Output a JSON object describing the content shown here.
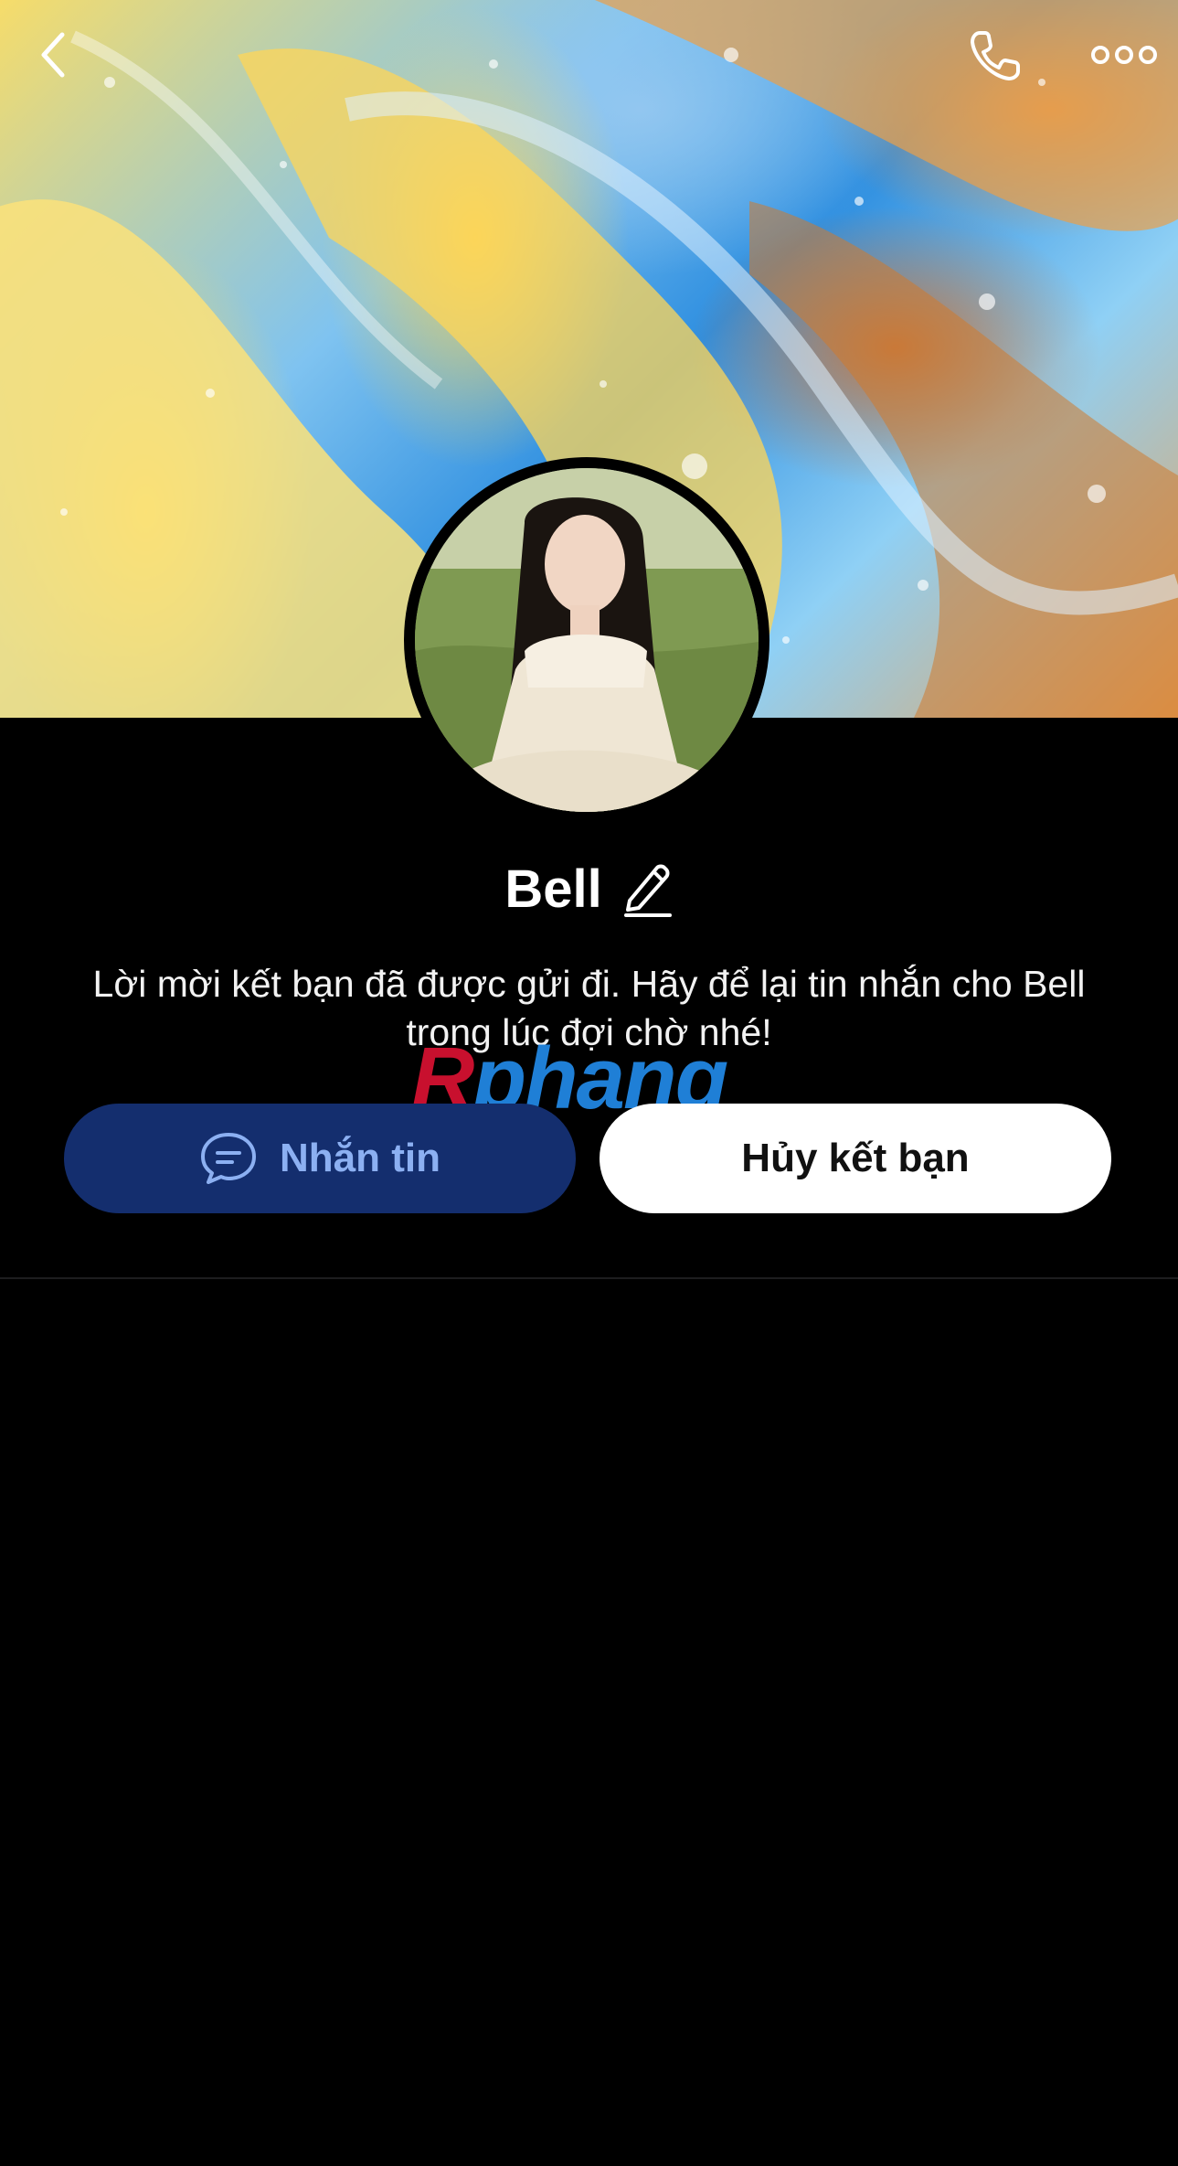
{
  "header": {
    "back_icon": "chevron-left-icon",
    "call_icon": "phone-icon",
    "more_icon": "more-dots-icon"
  },
  "profile": {
    "name": "Bell",
    "edit_icon": "pencil-icon",
    "status_message": "Lời mời kết bạn đã được gửi đi. Hãy để lại tin nhắn cho Bell trong lúc đợi chờ nhé!"
  },
  "actions": {
    "message_label": "Nhắn tin",
    "message_icon": "chat-bubble-icon",
    "unfriend_label": "Hủy kết bạn"
  },
  "watermark": {
    "r": "R",
    "rest": "phang"
  },
  "colors": {
    "background": "#000000",
    "message_button_bg": "#142e6e",
    "message_button_text": "#8cb0f2",
    "unfriend_button_bg": "#ffffff"
  }
}
